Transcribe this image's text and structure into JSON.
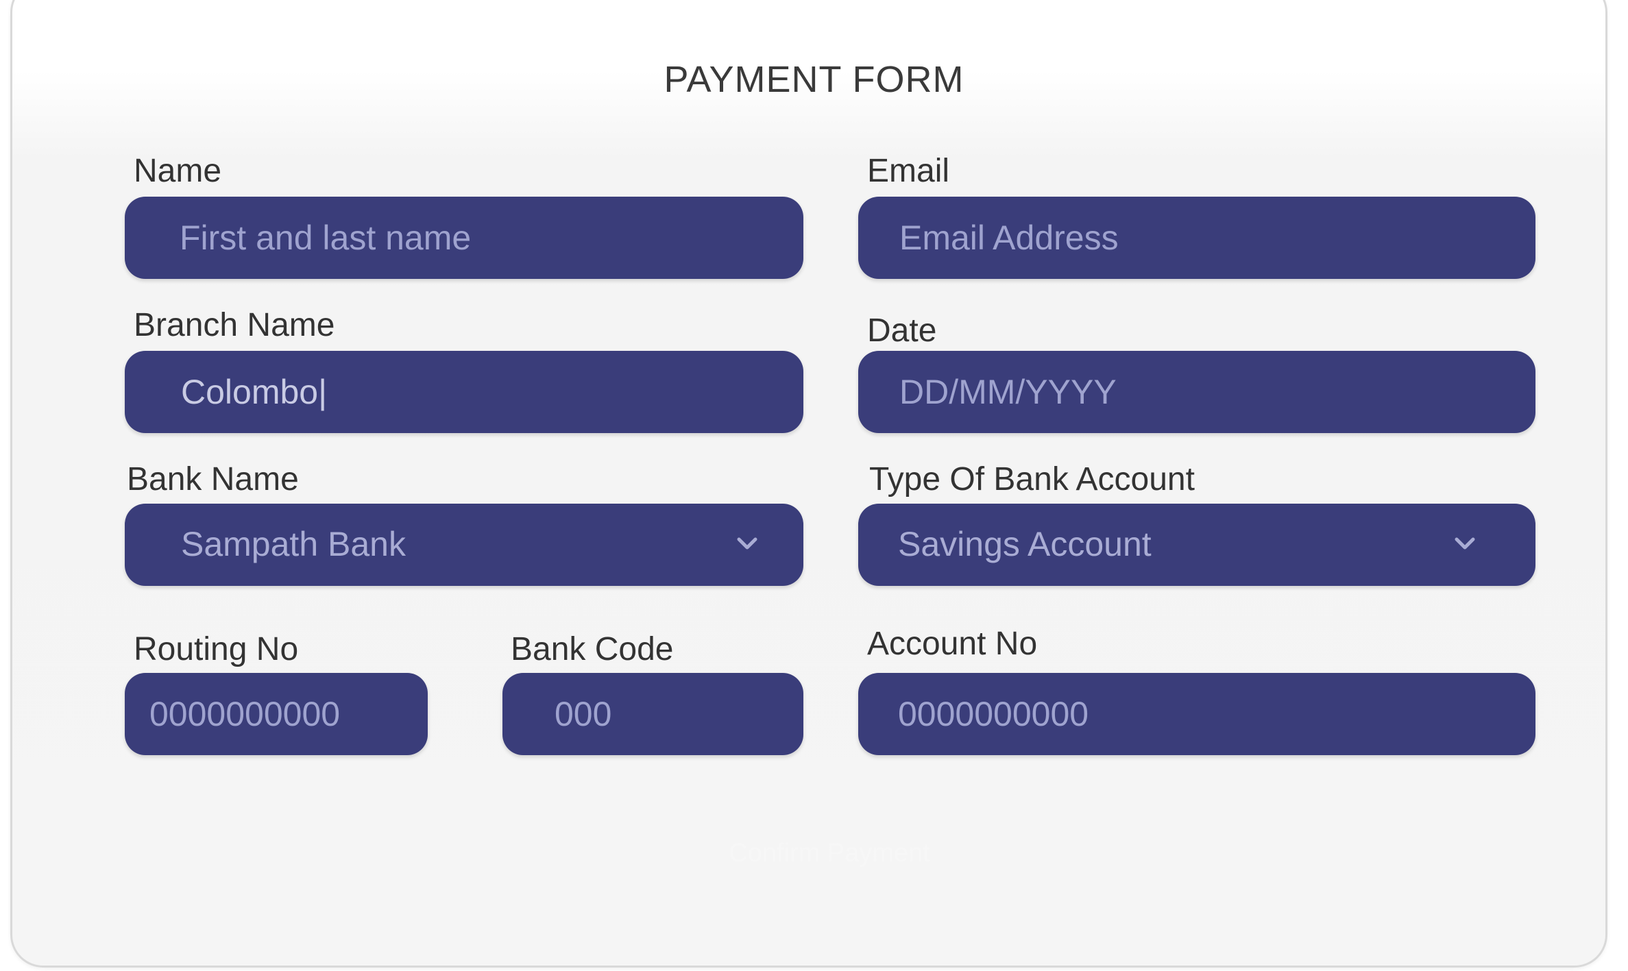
{
  "form": {
    "title": "PAYMENT FORM",
    "name": {
      "label": "Name",
      "placeholder": "First and last name",
      "value": ""
    },
    "email": {
      "label": "Email",
      "placeholder": "Email Address",
      "value": ""
    },
    "branch": {
      "label": "Branch Name",
      "placeholder": "",
      "value": "Colombo|"
    },
    "date": {
      "label": "Date",
      "placeholder": "DD/MM/YYYY",
      "value": ""
    },
    "bank": {
      "label": "Bank Name",
      "selected": "Sampath Bank"
    },
    "account_type": {
      "label": "Type Of Bank Account",
      "selected": "Savings Account"
    },
    "routing": {
      "label": "Routing No",
      "placeholder": "0000000000",
      "value": ""
    },
    "bank_code": {
      "label": "Bank Code",
      "placeholder": "000",
      "value": ""
    },
    "account_no": {
      "label": "Account No",
      "placeholder": "0000000000",
      "value": ""
    },
    "confirm_label": "Confirm Payment"
  },
  "colors": {
    "field_bg": "#3a3d7a",
    "placeholder": "#9fa3cf",
    "label": "#333333"
  },
  "icons": {
    "dropdown": "chevron-down-icon"
  }
}
